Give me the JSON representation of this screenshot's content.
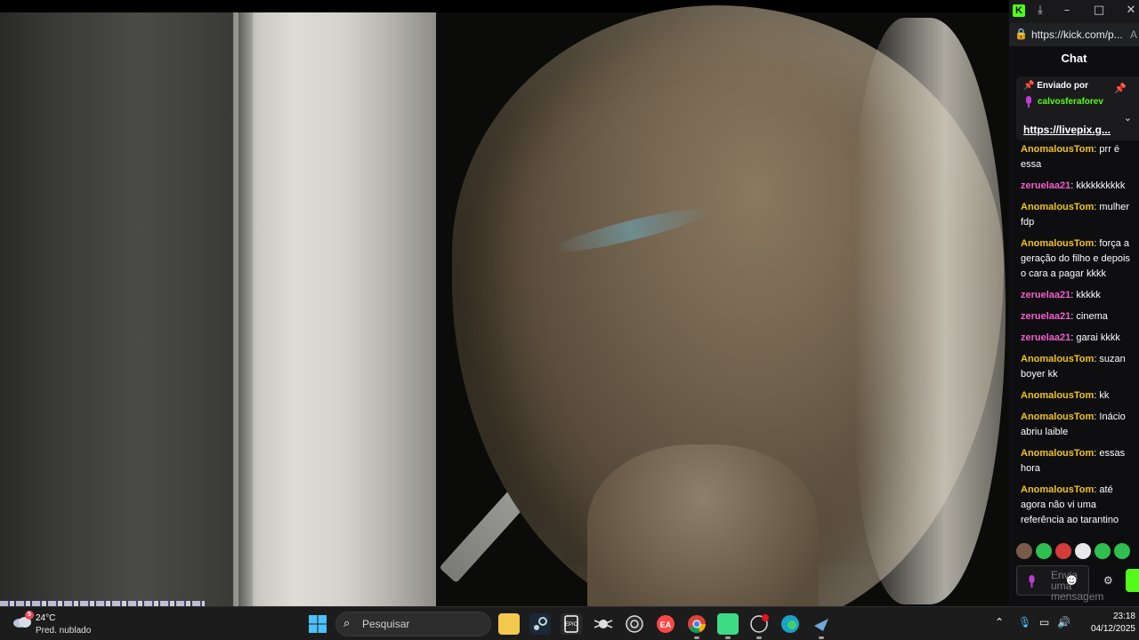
{
  "browser": {
    "url": "https://kick.com/p...",
    "url_overflow": "A"
  },
  "chat": {
    "title": "Chat",
    "pinned": {
      "label": "Enviado por",
      "user": "calvosferaforev",
      "link": "https://livepix.g..."
    },
    "messages": [
      {
        "user": "AnomalousTom",
        "text": "prr é essa",
        "color": "#f0c419"
      },
      {
        "user": "zeruelaa21",
        "text": "kkkkkkkkkk",
        "color": "#f45fcf"
      },
      {
        "user": "AnomalousTom",
        "text": "mulher fdp",
        "color": "#f0c419"
      },
      {
        "user": "AnomalousTom",
        "text": "força a geração do filho e depois o cara a pagar kkkk",
        "color": "#f0c419"
      },
      {
        "user": "zeruelaa21",
        "text": "kkkkk",
        "color": "#f45fcf"
      },
      {
        "user": "zeruelaa21",
        "text": "cinema",
        "color": "#f45fcf"
      },
      {
        "user": "zeruelaa21",
        "text": "garai kkkk",
        "color": "#f45fcf"
      },
      {
        "user": "AnomalousTom",
        "text": "suzan boyer kk",
        "color": "#f0c419"
      },
      {
        "user": "AnomalousTom",
        "text": "kk",
        "color": "#f0c419"
      },
      {
        "user": "AnomalousTom",
        "text": "Inácio abriu laible",
        "color": "#f0c419"
      },
      {
        "user": "AnomalousTom",
        "text": "essas hora",
        "color": "#f0c419"
      },
      {
        "user": "AnomalousTom",
        "text": "até agora não vi uma referência ao tarantino",
        "color": "#f0c419"
      }
    ],
    "input_placeholder": "Envia uma mensagem",
    "emotes": [
      "avatar-emote",
      "green-face-emote",
      "red-face-emote",
      "skull-emote",
      "green-chat-emote",
      "green-blob-emote"
    ]
  },
  "taskbar": {
    "weather_temp": "24°C",
    "weather_cond": "Pred. nublado",
    "weather_badge": "5",
    "search_placeholder": "Pesquisar",
    "time": "23:18",
    "date": "04/12/2025",
    "apps": [
      "file-explorer",
      "steam",
      "epic-games",
      "spider-app",
      "obs",
      "ea-app",
      "chrome",
      "android-app",
      "kick-app",
      "edge",
      "steam-2"
    ]
  },
  "colors": {
    "kick_green": "#53fc18",
    "user_yellow": "#f0c419",
    "user_pink": "#f45fcf"
  }
}
